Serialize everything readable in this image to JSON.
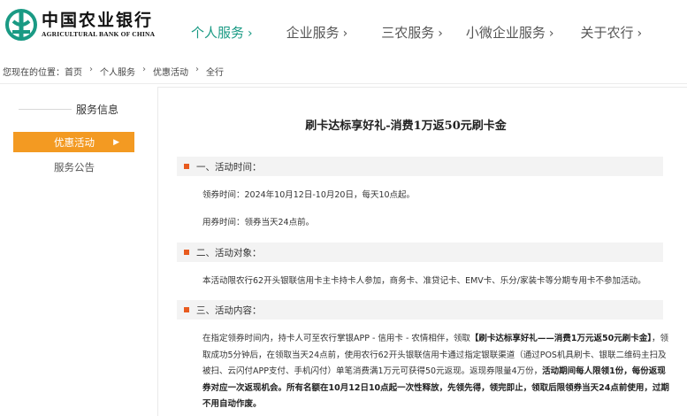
{
  "brand": {
    "name_cn": "中国农业银行",
    "name_en": "AGRICULTURAL BANK OF CHINA",
    "color": "#1a9a84"
  },
  "nav": {
    "items": [
      {
        "label": "个人服务",
        "arrow": "›",
        "active": true
      },
      {
        "label": "企业服务",
        "arrow": "›"
      },
      {
        "label": "三农服务",
        "arrow": "›"
      },
      {
        "label": "小微企业服务",
        "arrow": "›"
      },
      {
        "label": "关于农行",
        "arrow": "›"
      }
    ]
  },
  "breadcrumb": {
    "label": "您现在的位置：",
    "items": [
      "首页",
      "个人服务",
      "优惠活动",
      "全行"
    ],
    "sep": "›"
  },
  "sidebar": {
    "title": "服务信息",
    "active_item": {
      "label": "优惠活动",
      "arrow": "▶"
    },
    "items": [
      "服务公告"
    ],
    "accent": "#f39a22"
  },
  "article": {
    "title": "刷卡达标享好礼-消费1万返50元刷卡金",
    "sections": [
      {
        "heading": "一、活动时间：",
        "lines": [
          "领券时间：2024年10月12日-10月20日，每天10点起。",
          "用券时间：领券当天24点前。"
        ]
      },
      {
        "heading": "二、活动对象：",
        "lines": [
          "本活动限农行62开头银联信用卡主卡持卡人参加，商务卡、准贷记卡、EMV卡、乐分/家装卡等分期专用卡不参加活动。"
        ]
      },
      {
        "heading": "三、活动内容：",
        "segments": [
          {
            "t": "在指定领券时间内，持卡人可至农行掌银APP - 信用卡 - 农情相伴，领取"
          },
          {
            "t": "【刷卡达标享好礼——消费1万元返50元刷卡金】",
            "bold": true
          },
          {
            "t": "，领取成功5分钟后，在领取当天24点前，使用农行62开头银联信用卡通过指定银联渠道（通过POS机具刷卡、银联二维码主扫及被扫、云闪付APP支付、手机闪付）单笔消费满1万元可获得50元返现。返现券限量4万份，"
          },
          {
            "t": "活动期间每人限领1份，每份返现券对应一次返现机会。所有名额在10月12日10点起一次性释放，先领先得，领完即止，领取后限领券当天24点前使用，过期不用自动作废。",
            "bold": true
          }
        ]
      }
    ],
    "section_marker_color": "#e85b1f"
  }
}
